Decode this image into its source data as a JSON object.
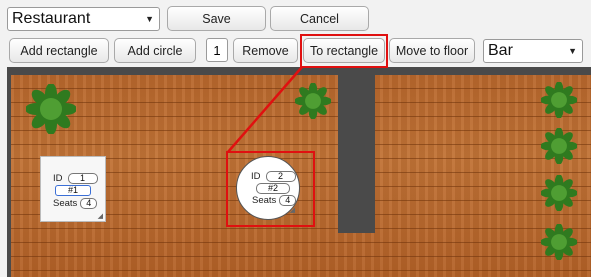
{
  "toolbar": {
    "restaurant_select": "Restaurant",
    "save_label": "Save",
    "cancel_label": "Cancel",
    "add_rectangle_label": "Add rectangle",
    "add_circle_label": "Add circle",
    "number_value": "1",
    "remove_label": "Remove",
    "to_rectangle_label": "To rectangle",
    "move_to_floor_label": "Move to floor",
    "floor_select": "Bar"
  },
  "tables": [
    {
      "shape": "rectangle",
      "id_label": "ID",
      "id": "1",
      "name": "#1",
      "seats_label": "Seats",
      "seats": "4"
    },
    {
      "shape": "circle",
      "id_label": "ID",
      "id": "2",
      "name": "#2",
      "seats_label": "Seats",
      "seats": "4"
    }
  ],
  "colors": {
    "highlight": "#e01010",
    "wood": "#c17336",
    "wall": "#4a4a4a",
    "plant": "#3f8f2a"
  },
  "icons": [
    "plant-icon",
    "resize-handle-icon",
    "dropdown-caret-icon"
  ]
}
